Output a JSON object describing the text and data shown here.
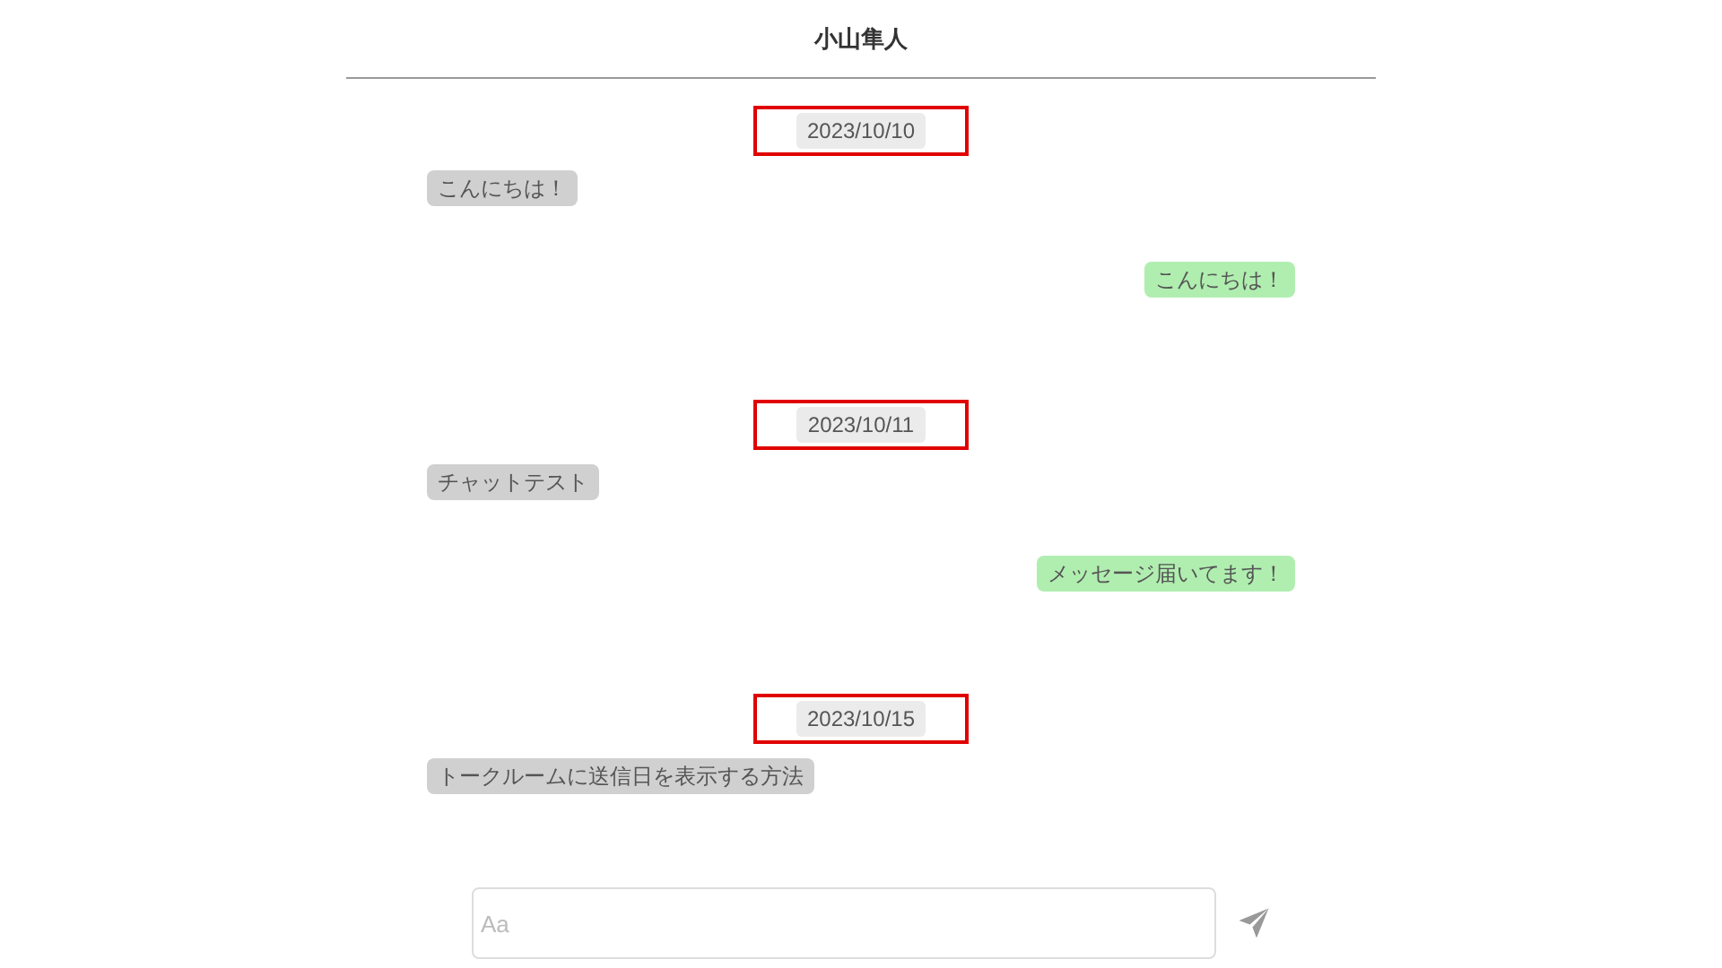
{
  "header": {
    "title": "小山隼人"
  },
  "messages": [
    {
      "kind": "date",
      "text": "2023/10/10",
      "highlighted": true
    },
    {
      "kind": "received",
      "text": "こんにちは！"
    },
    {
      "kind": "sent",
      "text": "こんにちは！"
    },
    {
      "kind": "date",
      "text": "2023/10/11",
      "highlighted": true
    },
    {
      "kind": "received",
      "text": "チャットテスト"
    },
    {
      "kind": "sent",
      "text": "メッセージ届いてます！"
    },
    {
      "kind": "date",
      "text": "2023/10/15",
      "highlighted": true
    },
    {
      "kind": "received",
      "text": "トークルームに送信日を表示する方法"
    }
  ],
  "composer": {
    "placeholder": "Aa"
  }
}
